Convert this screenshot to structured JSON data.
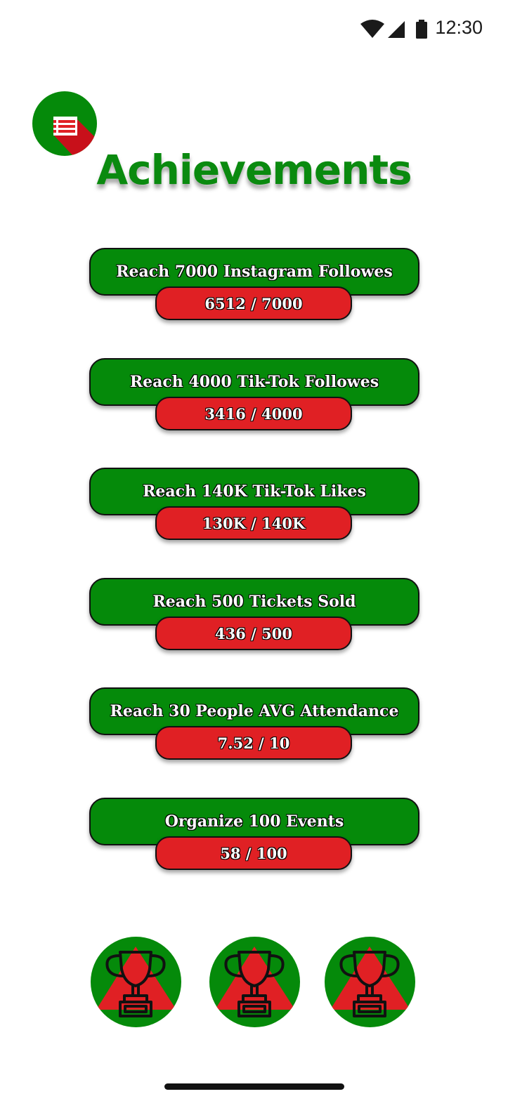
{
  "status_bar": {
    "time": "12:30",
    "icons": [
      "wifi-icon",
      "cellular-signal-icon",
      "battery-icon"
    ]
  },
  "menu_button": {
    "icon": "list-menu-icon"
  },
  "title": "Achievements",
  "achievements": [
    {
      "goal": "Reach 7000 Instagram Followes",
      "progress": "6512 / 7000"
    },
    {
      "goal": "Reach 4000 Tik-Tok Followes",
      "progress": "3416 / 4000"
    },
    {
      "goal": "Reach 140K Tik-Tok Likes",
      "progress": "130K / 140K"
    },
    {
      "goal": "Reach 500 Tickets Sold",
      "progress": "436 / 500"
    },
    {
      "goal": "Reach 30 People AVG Attendance",
      "progress": "7.52 / 10"
    },
    {
      "goal": "Organize 100 Events",
      "progress": "58 / 100"
    }
  ],
  "trophies": [
    {
      "icon": "trophy-icon"
    },
    {
      "icon": "trophy-icon"
    },
    {
      "icon": "trophy-icon"
    }
  ],
  "colors": {
    "primary_green": "#058a0a",
    "accent_red": "#e02024",
    "title_green": "#0a8a0f"
  }
}
